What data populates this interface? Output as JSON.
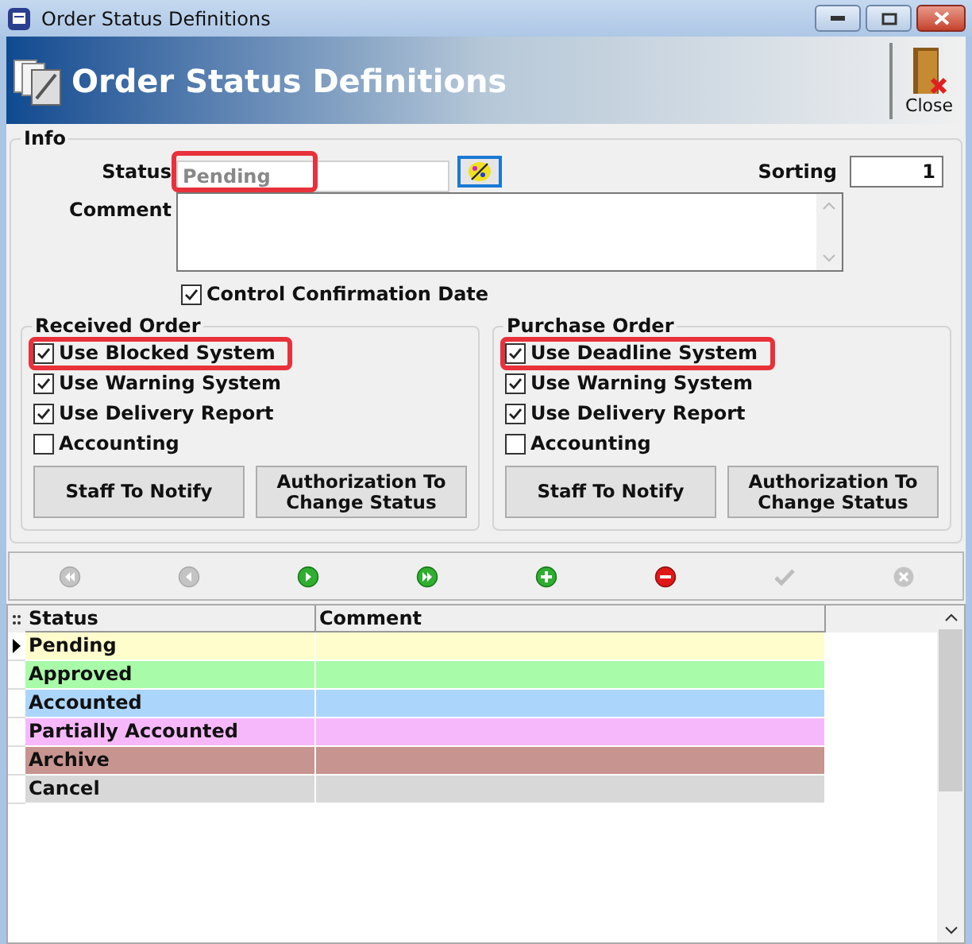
{
  "window": {
    "title": "Order Status Definitions"
  },
  "header": {
    "title": "Order Status Definitions",
    "close_label": "Close"
  },
  "info": {
    "legend": "Info",
    "status_label": "Status",
    "status_placeholder": "Pending",
    "status_highlighted": true,
    "sorting_label": "Sorting",
    "sorting_value": "1",
    "comment_label": "Comment",
    "control_confirmation": {
      "label": "Control Confirmation Date",
      "checked": true
    }
  },
  "groups": [
    {
      "legend": "Received Order",
      "options": [
        {
          "label": "Use Blocked System",
          "checked": true,
          "highlighted": true
        },
        {
          "label": "Use Warning System",
          "checked": true,
          "highlighted": false
        },
        {
          "label": "Use Delivery Report",
          "checked": true,
          "highlighted": false
        },
        {
          "label": "Accounting",
          "checked": false,
          "highlighted": false
        }
      ],
      "buttons": [
        "Staff To Notify",
        "Authorization To Change Status"
      ]
    },
    {
      "legend": "Purchase Order",
      "options": [
        {
          "label": "Use Deadline System",
          "checked": true,
          "highlighted": true
        },
        {
          "label": "Use Warning System",
          "checked": true,
          "highlighted": false
        },
        {
          "label": "Use Delivery Report",
          "checked": true,
          "highlighted": false
        },
        {
          "label": "Accounting",
          "checked": false,
          "highlighted": false
        }
      ],
      "buttons": [
        "Staff To Notify",
        "Authorization To Change Status"
      ]
    }
  ],
  "navigator": [
    {
      "kind": "first",
      "disabled": true
    },
    {
      "kind": "prior",
      "disabled": true
    },
    {
      "kind": "next",
      "disabled": false
    },
    {
      "kind": "last",
      "disabled": false
    },
    {
      "kind": "insert",
      "disabled": false
    },
    {
      "kind": "delete",
      "disabled": false
    },
    {
      "kind": "post",
      "disabled": true
    },
    {
      "kind": "cancel",
      "disabled": true
    }
  ],
  "table": {
    "columns": [
      "Status",
      "Comment"
    ],
    "rows": [
      {
        "status": "Pending",
        "color": "#fffdcc",
        "selected": true
      },
      {
        "status": "Approved",
        "color": "#a8fba8",
        "selected": false
      },
      {
        "status": "Accounted",
        "color": "#acd5fc",
        "selected": false
      },
      {
        "status": "Partially Accounted",
        "color": "#f7b8fb",
        "selected": false
      },
      {
        "status": "Archive",
        "color": "#c79490",
        "selected": false
      },
      {
        "status": "Cancel",
        "color": "#d8d8d8",
        "selected": false
      }
    ]
  }
}
